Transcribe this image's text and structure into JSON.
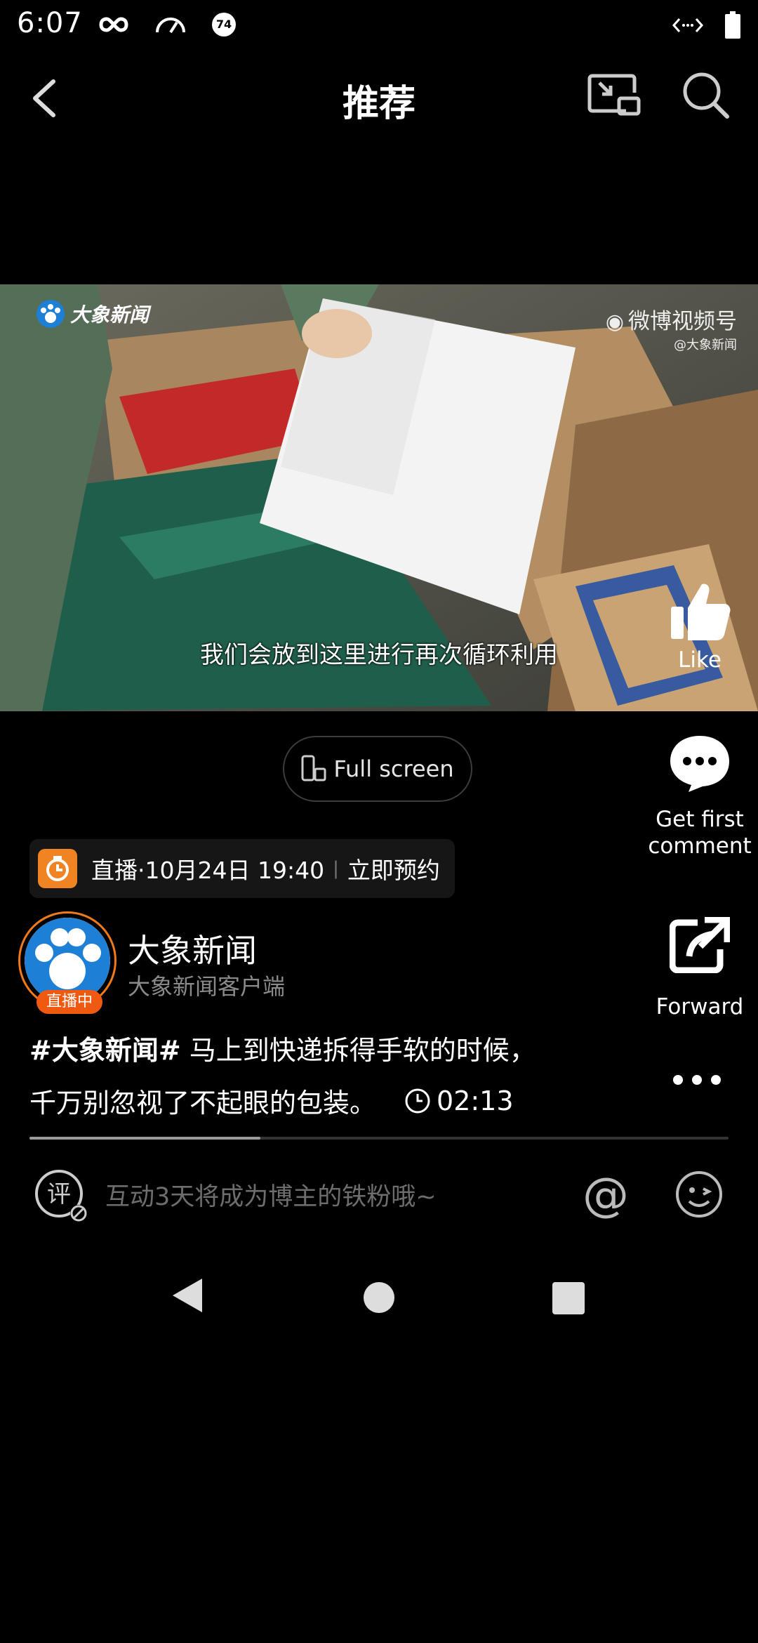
{
  "status_bar": {
    "time": "6:07",
    "icons": [
      "infinity-icon",
      "speedometer-icon",
      "notification-74-icon"
    ],
    "badge_number": "74",
    "right_icons": [
      "data-transfer-icon",
      "battery-icon"
    ]
  },
  "header": {
    "title": "推荐",
    "back_icon": "chevron-left-icon",
    "cast_icon": "screen-cast-icon",
    "search_icon": "search-icon"
  },
  "video": {
    "subtitle": "我们会放到这里进行再次循环利用",
    "watermark_left": "大象新闻",
    "watermark_right": "微博视频号",
    "watermark_right_sub": "@大象新闻"
  },
  "actions": {
    "like_label": "Like",
    "comment_label_1": "Get first",
    "comment_label_2": "comment",
    "forward_label": "Forward",
    "more_icon": "more-dots-icon"
  },
  "fullscreen": {
    "label": "Full screen"
  },
  "live_banner": {
    "text": "直播·10月24日 19:40",
    "cta": "立即预约",
    "separator": "|"
  },
  "author": {
    "name": "大象新闻",
    "subtitle": "大象新闻客户端",
    "live_badge": "直播中"
  },
  "post": {
    "hashtag": "#大象新闻#",
    "text_line1": " 马上到快递拆得手软的时候，",
    "text_line2": "千万别忽视了不起眼的包装。",
    "duration": "02:13",
    "progress": 0.33
  },
  "comment_bar": {
    "placeholder": "互动3天将成为博主的铁粉哦~",
    "at_symbol": "@"
  },
  "colors": {
    "accent_orange": "#f08422",
    "live_badge": "#f05a10",
    "background": "#000000"
  }
}
